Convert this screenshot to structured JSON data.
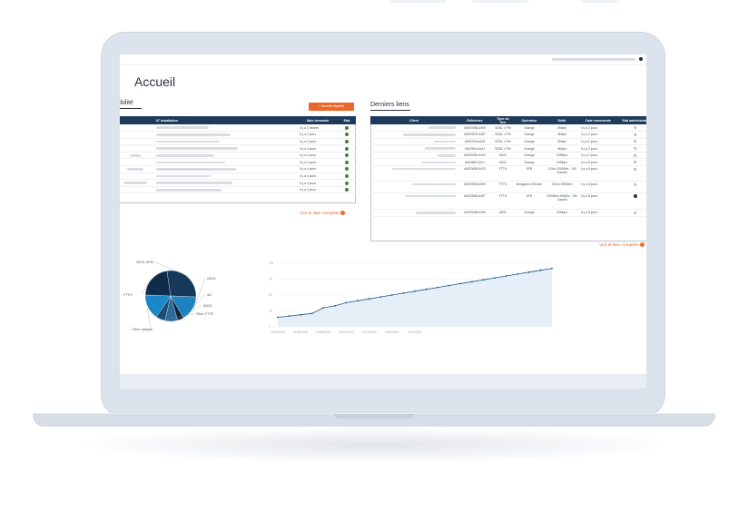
{
  "page": {
    "title": "Accueil"
  },
  "eligibility": {
    "title": "ligibilité",
    "new_button": "+ Nouvelle éligibilité",
    "columns": [
      "N° installation",
      "Date demande",
      "Etat"
    ],
    "rows": [
      {
        "date": "il y a 3 heures"
      },
      {
        "date": "il y a 2 jours"
      },
      {
        "date": "il y a 2 jours"
      },
      {
        "date": "il y a 4 jours"
      },
      {
        "date": "il y a 4 jours"
      },
      {
        "date": "il y a 4 jours"
      },
      {
        "date": "il y a 4 jours"
      },
      {
        "date": "il y a 4 jours"
      },
      {
        "date": "il y a 4 jours"
      },
      {
        "date": "il y a 4 jours"
      }
    ],
    "see_all": "Voir la liste complète"
  },
  "links": {
    "title": "Derniers liens",
    "columns": [
      "Client",
      "Référence",
      "Type de lien",
      "Opérateur",
      "Débit",
      "Date commande",
      "Etat administratif"
    ],
    "rows": [
      {
        "ref": "AWS0398-6490",
        "type": "SDSL 4 FM",
        "op": "Orange",
        "debit": "2Mbps",
        "date": "il y a 2 jours"
      },
      {
        "ref": "AWS0876-6487",
        "type": "SDSL 4 FM",
        "op": "Orange",
        "debit": "4Mbps",
        "date": "il y a 2 jours"
      },
      {
        "ref": "AWS700-6446",
        "type": "SDSL 4 FM",
        "op": "Orange",
        "debit": "2Mbps",
        "date": "il y a 2 jours"
      },
      {
        "ref": "AWS454-6444",
        "type": "SDSL 4 FM",
        "op": "Orange",
        "debit": "3Mbps",
        "date": "il y a 2 jours"
      },
      {
        "ref": "AWS0255-6443",
        "type": "ADSL",
        "op": "Orange",
        "debit": "20Mbps",
        "date": "il y a 2 jours"
      },
      {
        "ref": "AWS869-6421",
        "type": "ADSL",
        "op": "Orange",
        "debit": "20Mbps",
        "date": "il y a 8 jours"
      },
      {
        "ref": "AWS0698-6420",
        "type": "FTTH",
        "op": "SFR",
        "debit": "1Gb/s 200Mb/s - SM Garanti",
        "date": "il y a 8 jours"
      },
      {
        "ref": "AWS0548-6490",
        "type": "FTTH",
        "op": "Bouygues Telecom",
        "debit": "1Gb/s 250Mb/s",
        "date": "il y a 8 jours"
      },
      {
        "ref": "AWS0548-6457",
        "type": "FTTH",
        "op": "SFR",
        "debit": "200Mb/s 40Mb/s - SM Garanti",
        "date": "il y a 8 jours"
      },
      {
        "ref": "AWS0458-6496",
        "type": "ADSL",
        "op": "Orange",
        "debit": "20Mbps",
        "date": "il y a 8 jours"
      }
    ],
    "see_all": "Voir la liste complète"
  },
  "chart_data": [
    {
      "type": "pie",
      "categories": [
        "SDSL EFM",
        "VDSL",
        "4G",
        "ADSL",
        "Fibre FTTE",
        "Fibre optique",
        "FTTH"
      ],
      "values": [
        28,
        16,
        4,
        8,
        6,
        16,
        22
      ],
      "colors": [
        "#16395a",
        "#1e82c0",
        "#0e2438",
        "#2d6a9a",
        "#1b4f7a",
        "#1b86c8",
        "#0f2d4a"
      ]
    },
    {
      "type": "line",
      "x": [
        "01/04/2020",
        "01/05/2020",
        "01/06/2020",
        "01/07/2020",
        "01/08/2020",
        "01/09/2020",
        "01/10/2020",
        "01/11/2020",
        "01/12/2020",
        "01/01/2021",
        "01/02/2021",
        "01/03/2021",
        "01/04/2021",
        "01/05/2021",
        "01/06/2021",
        "01/07/2021",
        "01/08/2021",
        "01/09/2021",
        "01/10/2021",
        "01/11/2021",
        "01/12/2021",
        "01/01/2022",
        "01/02/2022",
        "01/03/2022",
        "01/04/2022"
      ],
      "values": [
        15,
        17,
        19,
        21,
        30,
        33,
        38,
        41,
        44,
        47,
        50,
        53,
        56,
        59,
        62,
        65,
        68,
        71,
        74,
        77,
        80,
        83,
        86,
        89,
        92
      ],
      "xticks": [
        "01/04/2020",
        "01/06/2020",
        "01/08/2020",
        "01/10/2020",
        "01/12/2020",
        "01/02/2021",
        "01/04/2021"
      ],
      "yticks": [
        "0",
        "25",
        "50",
        "75",
        "100"
      ],
      "ylim": [
        0,
        100
      ],
      "line_color": "#1e5d8c",
      "fill_color": "#e6eef7"
    }
  ]
}
